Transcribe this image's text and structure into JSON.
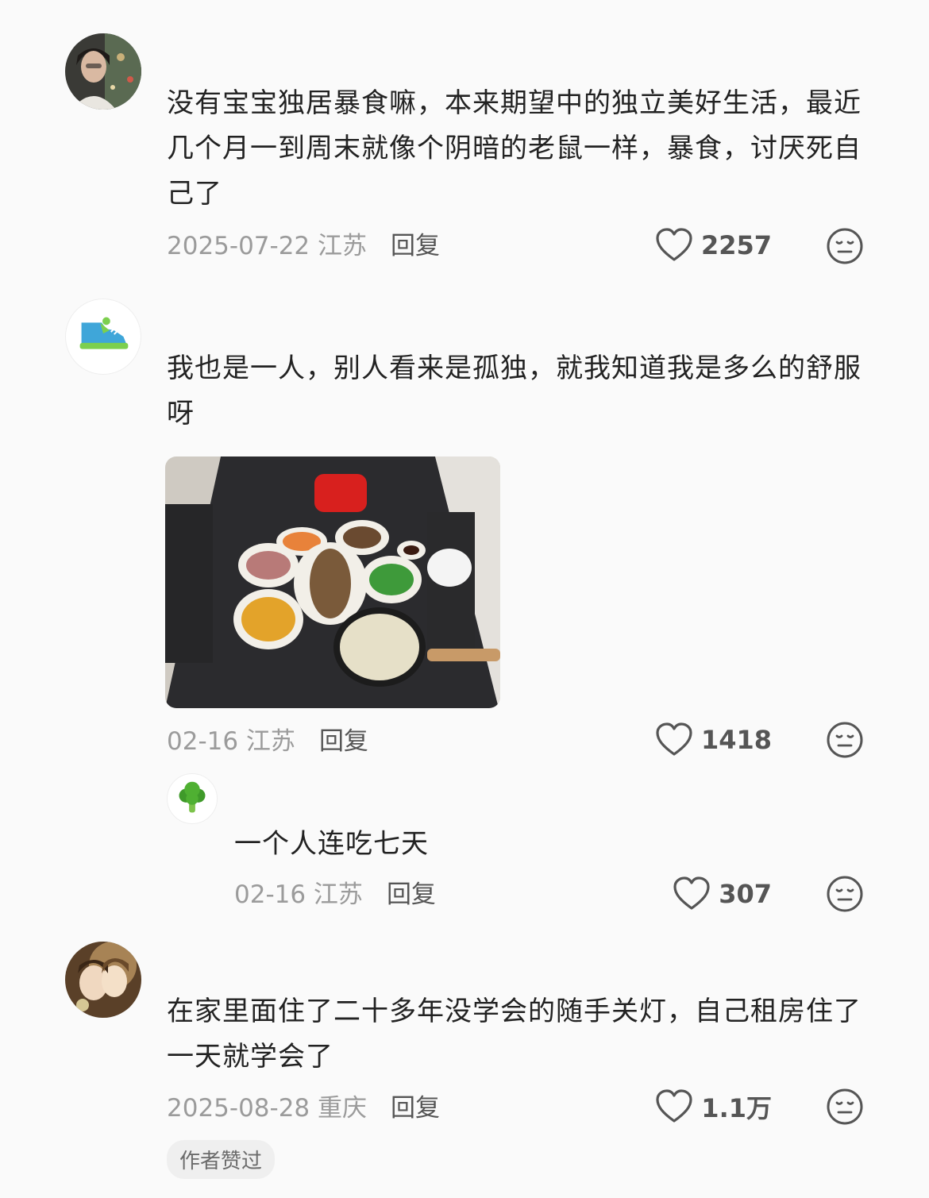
{
  "comments": [
    {
      "text": "没有宝宝独居暴食嘛，本来期望中的独立美好生活，最近几个月一到周末就像个阴暗的老鼠一样，暴食，讨厌死自己了",
      "date_location": "2025-07-22 江苏",
      "reply_label": "回复",
      "likes": "2257",
      "avatar_icon": "person-photo-avatar"
    },
    {
      "text": "我也是一人，别人看来是孤独，就我知道我是多么的舒服呀",
      "date_location": "02-16 江苏",
      "reply_label": "回复",
      "likes": "1418",
      "avatar_icon": "sneaker-avatar",
      "reply": {
        "text": "一个人连吃七天",
        "date_location": "02-16 江苏",
        "reply_label": "回复",
        "likes": "307",
        "avatar_icon": "broccoli-avatar"
      }
    },
    {
      "text": "在家里面住了二十多年没学会的随手关灯，自己租房住了一天就学会了",
      "date_location": "2025-08-28 重庆",
      "reply_label": "回复",
      "likes": "1.1万",
      "avatar_icon": "anime-girls-avatar",
      "badge": "作者赞过"
    }
  ],
  "colors": {
    "background": "#fafafa",
    "meta_gray": "#9b9b9b",
    "text": "#222222"
  }
}
